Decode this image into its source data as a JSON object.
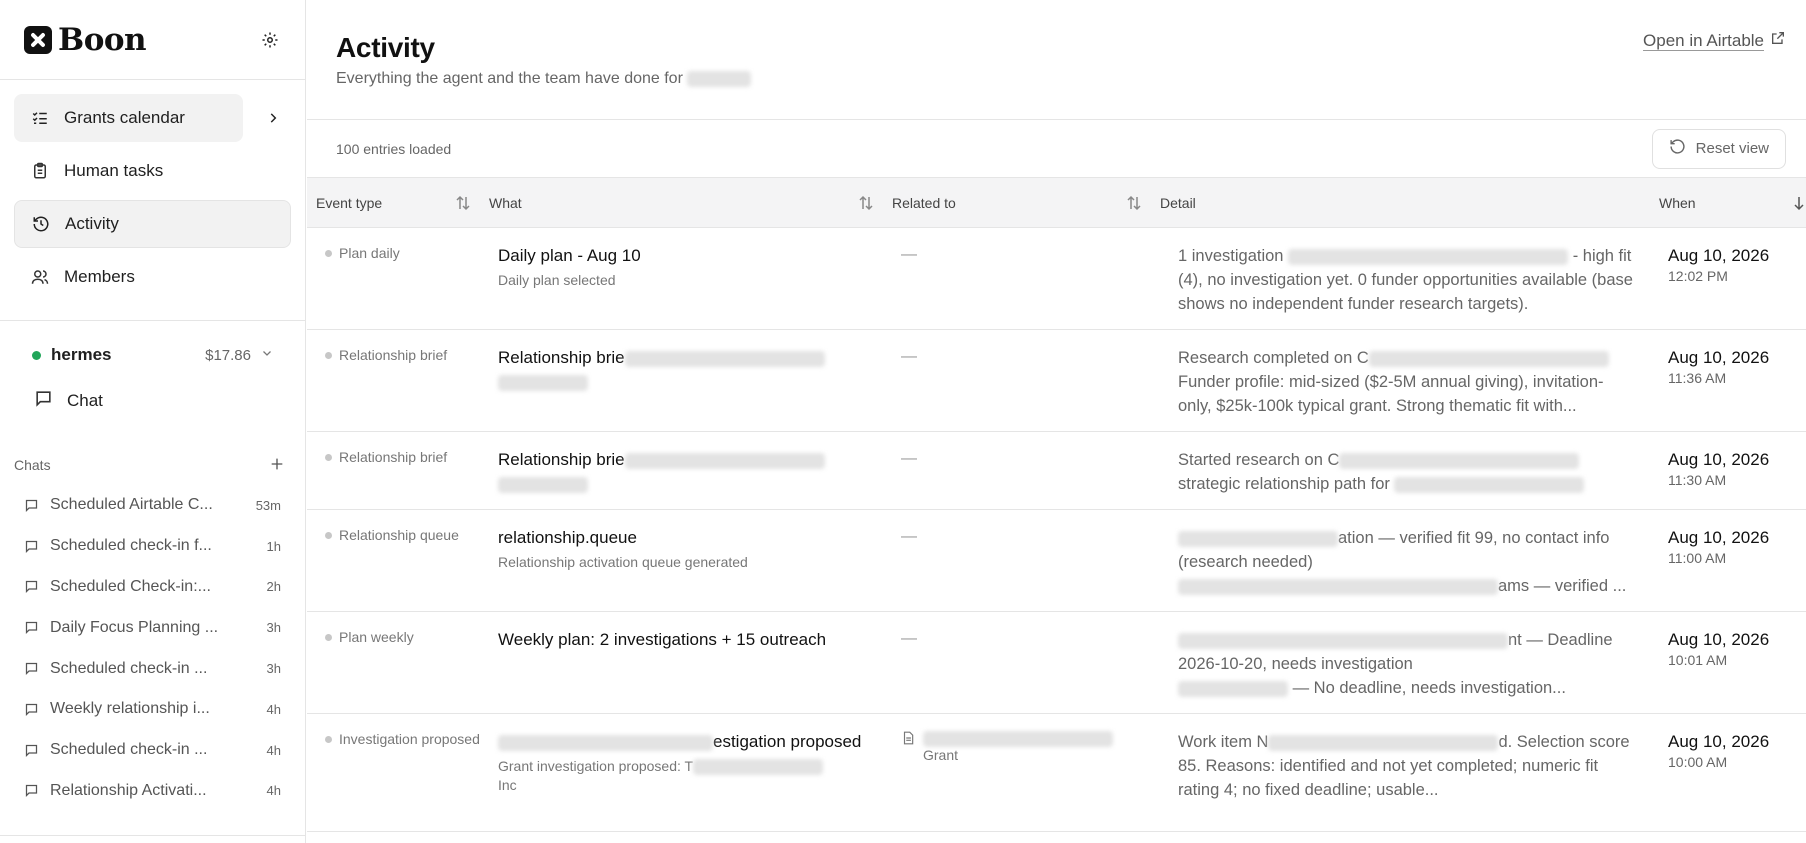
{
  "brand": {
    "name": "Boon"
  },
  "nav": [
    {
      "label": "Grants calendar",
      "icon": "checklist-icon"
    },
    {
      "label": "Human tasks",
      "icon": "clipboard-icon"
    },
    {
      "label": "Activity",
      "icon": "history-icon"
    },
    {
      "label": "Members",
      "icon": "users-icon"
    }
  ],
  "workspace": {
    "name": "hermes",
    "amount": "$17.86",
    "status_color": "#22a65a"
  },
  "chat_link": {
    "label": "Chat"
  },
  "chats": {
    "heading": "Chats",
    "items": [
      {
        "title": "Scheduled Airtable C...",
        "age": "53m"
      },
      {
        "title": "Scheduled check-in f...",
        "age": "1h"
      },
      {
        "title": "Scheduled Check-in:...",
        "age": "2h"
      },
      {
        "title": "Daily Focus Planning ...",
        "age": "3h"
      },
      {
        "title": "Scheduled check-in ...",
        "age": "3h"
      },
      {
        "title": "Weekly relationship i...",
        "age": "4h"
      },
      {
        "title": "Scheduled check-in ...",
        "age": "4h"
      },
      {
        "title": "Relationship Activati...",
        "age": "4h"
      }
    ]
  },
  "header": {
    "title": "Activity",
    "subtitle": "Everything the agent and the team have done for",
    "open_link": "Open in Airtable"
  },
  "toolbar": {
    "count": "100 entries loaded",
    "reset": "Reset view"
  },
  "table": {
    "columns": [
      "Event type",
      "What",
      "Related to",
      "Detail",
      "When"
    ],
    "rows": [
      {
        "event": "Plan daily",
        "what": "Daily plan - Aug 10",
        "what_sub": "Daily plan selected",
        "related": "—",
        "detail": [
          "1 investigation",
          "- high fit (4), no investigation yet. 0 funder opportunities available (base shows no independent funder research targets)."
        ],
        "date": "Aug 10, 2026",
        "time": "12:02 PM"
      },
      {
        "event": "Relationship brief",
        "what": "Relationship brie",
        "related": "—",
        "detail": [
          "Research completed on C",
          "Funder profile: mid-sized ($2-5M annual giving), invitation-only, $25k-100k typical grant. Strong thematic fit with..."
        ],
        "date": "Aug 10, 2026",
        "time": "11:36 AM"
      },
      {
        "event": "Relationship brief",
        "what": "Relationship brie",
        "related": "—",
        "detail": [
          "Started research on C",
          "strategic relationship path for"
        ],
        "date": "Aug 10, 2026",
        "time": "11:30 AM"
      },
      {
        "event": "Relationship queue",
        "what": "relationship.queue",
        "what_sub": "Relationship activation queue generated",
        "related": "—",
        "detail": [
          "ation — verified fit 99, no contact info (research needed)",
          "ams — verified ..."
        ],
        "date": "Aug 10, 2026",
        "time": "11:00 AM"
      },
      {
        "event": "Plan weekly",
        "what": "Weekly plan: 2 investigations + 15 outreach",
        "related": "—",
        "detail": [
          "nt — Deadline 2026-10-20, needs investigation",
          "— No deadline, needs investigation..."
        ],
        "date": "Aug 10, 2026",
        "time": "10:01 AM"
      },
      {
        "event": "Investigation proposed",
        "what": "estigation proposed",
        "what_sub": "Grant investigation proposed: T",
        "what_sub2": "Inc",
        "related": "Grant",
        "detail": [
          "Work item N",
          "d. Selection score 85. Reasons: identified and not yet completed; numeric fit rating 4; no fixed deadline; usable..."
        ],
        "date": "Aug 10, 2026",
        "time": "10:00 AM"
      }
    ]
  }
}
